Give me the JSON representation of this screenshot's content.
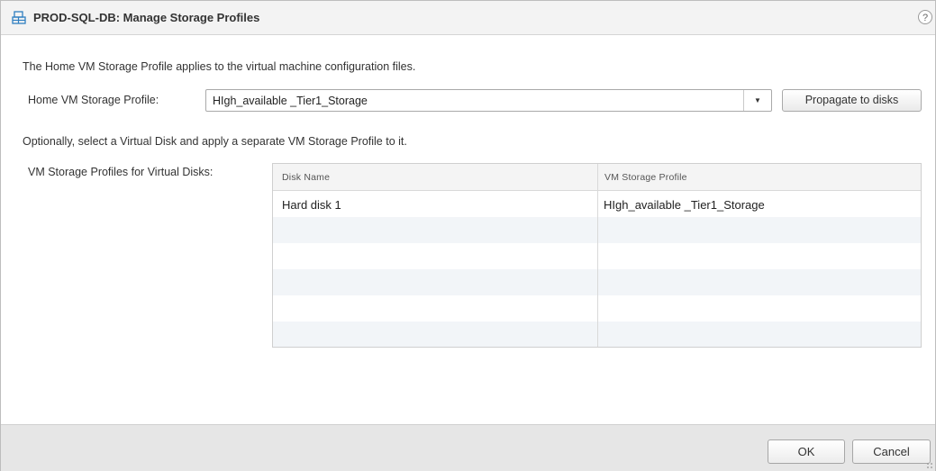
{
  "dialog": {
    "title": "PROD-SQL-DB: Manage Storage Profiles",
    "help_label": "?"
  },
  "home": {
    "intro_text": "The Home VM Storage Profile applies to the virtual machine configuration files.",
    "label": "Home VM Storage Profile:",
    "selected_profile": "HIgh_available _Tier1_Storage",
    "dropdown_arrow": "▼",
    "propagate_label": "Propagate to disks"
  },
  "virtual_disks": {
    "optional_text": "Optionally, select a Virtual Disk and apply a separate VM Storage Profile to it.",
    "label": "VM Storage Profiles for Virtual Disks:",
    "columns": [
      "Disk Name",
      "VM Storage Profile"
    ],
    "rows": [
      {
        "disk_name": "Hard disk 1",
        "profile": "HIgh_available _Tier1_Storage"
      }
    ]
  },
  "footer": {
    "ok_label": "OK",
    "cancel_label": "Cancel"
  },
  "icons": {
    "title_icon": "vm-storage-icon",
    "help_icon": "help-icon"
  },
  "colors": {
    "titlebar_bg": "#f3f3f3",
    "footer_bg": "#e6e6e6",
    "alt_row": "#f2f5f8",
    "icon_blue": "#2f7fc1"
  }
}
